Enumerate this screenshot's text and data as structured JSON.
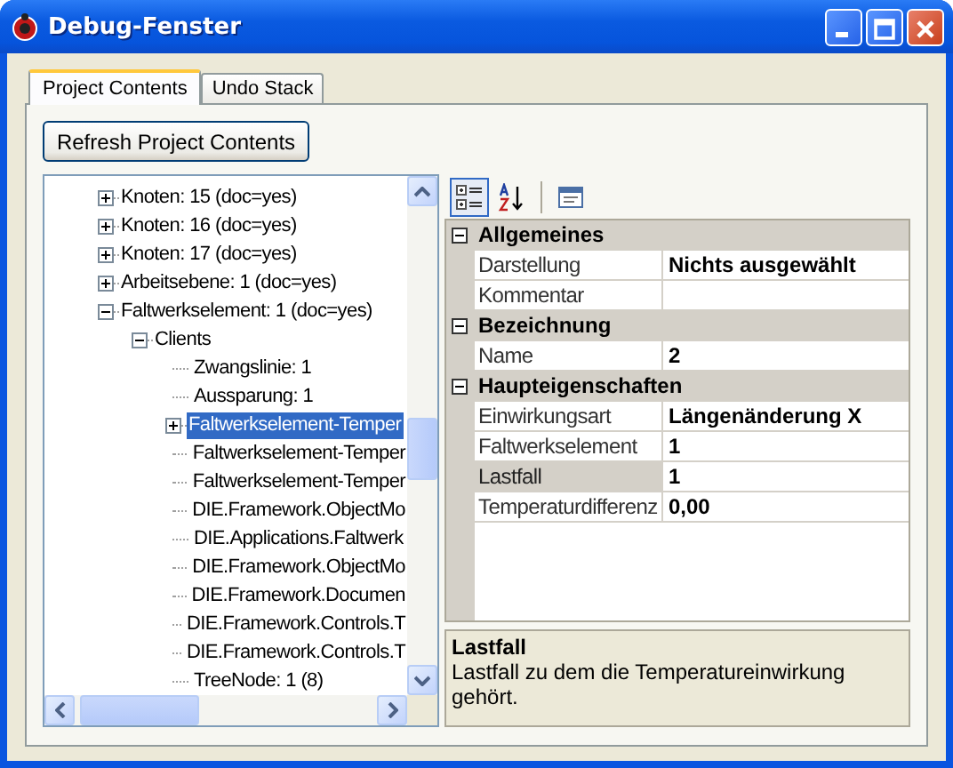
{
  "window": {
    "title": "Debug-Fenster"
  },
  "tabs": [
    {
      "label": "Project Contents",
      "selected": true
    },
    {
      "label": "Undo Stack",
      "selected": false
    }
  ],
  "refresh_button": "Refresh Project Contents",
  "tree": {
    "items": [
      {
        "label": "Knoten: 15 (doc=yes)",
        "expanded": false,
        "selected": false
      },
      {
        "label": "Knoten: 16 (doc=yes)",
        "expanded": false,
        "selected": false
      },
      {
        "label": "Knoten: 17 (doc=yes)",
        "expanded": false,
        "selected": false
      },
      {
        "label": "Arbeitsebene: 1 (doc=yes)",
        "expanded": false,
        "selected": false
      },
      {
        "label": "Faltwerkselement: 1 (doc=yes)",
        "expanded": true,
        "selected": false,
        "children": [
          {
            "label": "Clients",
            "expanded": true,
            "selected": false,
            "children": [
              {
                "label": "Zwangslinie: 1",
                "selected": false
              },
              {
                "label": "Aussparung: 1",
                "selected": false
              },
              {
                "label": "Faltwerkselement-Temper",
                "expanded": false,
                "selected": true
              },
              {
                "label": "Faltwerkselement-Temper",
                "selected": false
              },
              {
                "label": "Faltwerkselement-Temper",
                "selected": false
              },
              {
                "label": "DIE.Framework.ObjectMo",
                "selected": false
              },
              {
                "label": "DIE.Applications.Faltwerk",
                "selected": false
              },
              {
                "label": "DIE.Framework.ObjectMo",
                "selected": false
              },
              {
                "label": "DIE.Framework.Documen",
                "selected": false
              },
              {
                "label": "DIE.Framework.Controls.T",
                "selected": false
              },
              {
                "label": "DIE.Framework.Controls.T",
                "selected": false
              },
              {
                "label": "TreeNode: 1 (8)",
                "selected": false
              }
            ]
          }
        ]
      }
    ]
  },
  "property_grid": {
    "categories": [
      {
        "name": "Allgemeines",
        "expanded": true,
        "properties": [
          {
            "name": "Darstellung",
            "value": "Nichts ausgewählt",
            "selected": false
          },
          {
            "name": "Kommentar",
            "selected": false
          }
        ]
      },
      {
        "name": "Bezeichnung",
        "expanded": true,
        "properties": [
          {
            "name": "Name",
            "value": "2",
            "selected": false
          }
        ]
      },
      {
        "name": "Haupteigenschaften",
        "expanded": true,
        "properties": [
          {
            "name": "Einwirkungsart",
            "value": "Längenänderung X",
            "selected": false
          },
          {
            "name": "Faltwerkselement",
            "value": "1",
            "selected": false
          },
          {
            "name": "Lastfall",
            "value": "1",
            "selected": true
          },
          {
            "name": "Temperaturdifferenz",
            "value": "0,00",
            "selected": false
          }
        ]
      }
    ],
    "help": {
      "title": "Lastfall",
      "text": "Lastfall zu dem die Temperatureinwirkung gehört."
    }
  }
}
